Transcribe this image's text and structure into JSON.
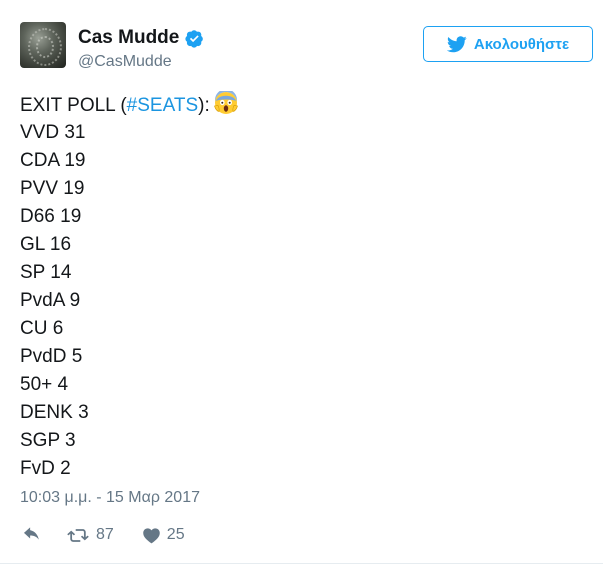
{
  "user": {
    "display_name": "Cas Mudde",
    "handle": "@CasMudde",
    "avatar_icon": "avatar-image",
    "verified_icon": "verified-badge-icon"
  },
  "follow_button": {
    "label": "Ακολουθήστε",
    "icon": "twitter-bird-icon",
    "color": "#1da1f2"
  },
  "tweet": {
    "header": {
      "prefix": "EXIT POLL (",
      "hashtag": "#SEATS",
      "suffix": "):",
      "emoji": "face-screaming-in-fear-icon"
    },
    "results": [
      {
        "text": "VVD 31"
      },
      {
        "text": "CDA 19"
      },
      {
        "text": "PVV 19"
      },
      {
        "text": "D66 19"
      },
      {
        "text": "GL 16"
      },
      {
        "text": "SP 14"
      },
      {
        "text": "PvdA 9"
      },
      {
        "text": "CU 6"
      },
      {
        "text": "PvdD 5"
      },
      {
        "text": "50+ 4"
      },
      {
        "text": "DENK 3"
      },
      {
        "text": "SGP 3"
      },
      {
        "text": "FvD 2"
      }
    ],
    "timestamp": "10:03 μ.μ. - 15 Μαρ 2017",
    "hashtag_color": "#1b95e0"
  },
  "actions": {
    "reply_icon": "reply-icon",
    "retweet_icon": "retweet-icon",
    "retweet_count": "87",
    "like_icon": "heart-icon",
    "like_count": "25"
  }
}
